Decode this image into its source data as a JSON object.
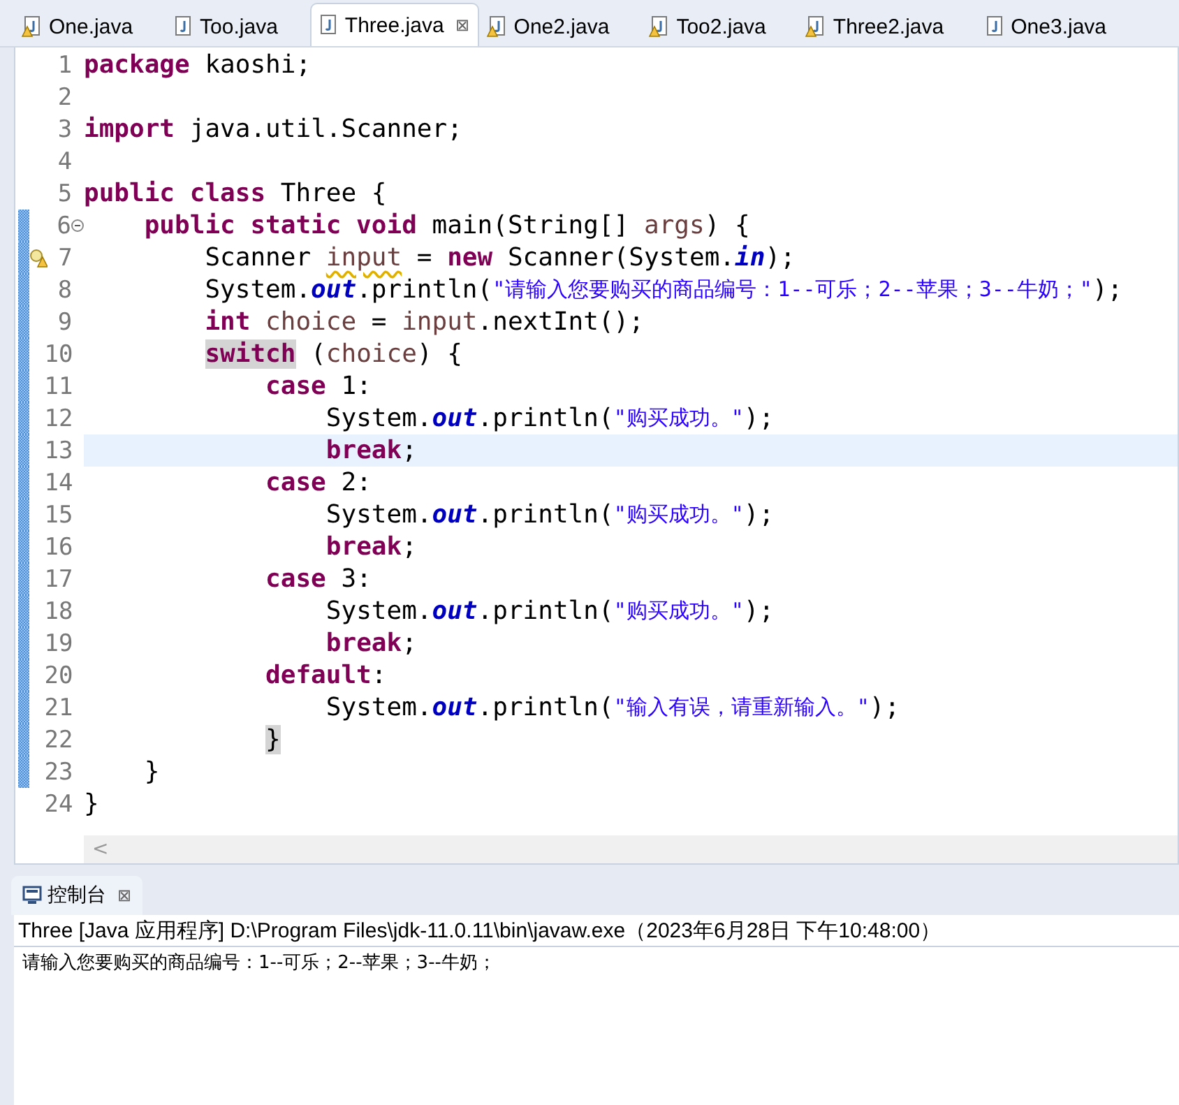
{
  "tabs": [
    {
      "label": "One.java",
      "warning": true,
      "selected": false
    },
    {
      "label": "Too.java",
      "warning": false,
      "selected": false
    },
    {
      "label": "Three.java",
      "warning": false,
      "selected": true,
      "close": "⊠"
    },
    {
      "label": "One2.java",
      "warning": true,
      "selected": false
    },
    {
      "label": "Too2.java",
      "warning": true,
      "selected": false
    },
    {
      "label": "Three2.java",
      "warning": true,
      "selected": false
    },
    {
      "label": "One3.java",
      "warning": false,
      "selected": false
    }
  ],
  "editor": {
    "lines": [
      {
        "number": "1",
        "changed": false,
        "tokens": [
          {
            "t": "package",
            "kind": "kw"
          },
          {
            "t": " kaoshi;",
            "kind": "plain"
          }
        ]
      },
      {
        "number": "2",
        "changed": false
      },
      {
        "number": "3",
        "changed": false,
        "tokens": [
          {
            "t": "import",
            "kind": "kw"
          },
          {
            "t": " java.util.Scanner;",
            "kind": "plain"
          }
        ]
      },
      {
        "number": "4",
        "changed": false
      },
      {
        "number": "5",
        "changed": false,
        "tokens": [
          {
            "t": "public class",
            "kind": "kw"
          },
          {
            "t": " Three {",
            "kind": "plain"
          }
        ],
        "children": [
          {
            "number": "6",
            "changed": true,
            "fold": true,
            "tokens": [
              {
                "t": "public static void",
                "kind": "kw"
              },
              {
                "t": " main(String[] ",
                "kind": "plain"
              },
              {
                "t": "args",
                "kind": "var"
              },
              {
                "t": ") {",
                "kind": "plain"
              }
            ],
            "children": [
              {
                "number": "7",
                "changed": true,
                "warning": true,
                "tokens": [
                  {
                    "t": "Scanner ",
                    "kind": "plain"
                  },
                  {
                    "t": "input",
                    "kind": "var",
                    "squiggle": true
                  },
                  {
                    "t": " = ",
                    "kind": "plain"
                  },
                  {
                    "t": "new",
                    "kind": "kw"
                  },
                  {
                    "t": " Scanner(System.",
                    "kind": "plain"
                  },
                  {
                    "t": "in",
                    "kind": "field"
                  },
                  {
                    "t": ");",
                    "kind": "plain"
                  }
                ]
              },
              {
                "number": "8",
                "changed": true,
                "tokens": [
                  {
                    "t": "System.",
                    "kind": "plain"
                  },
                  {
                    "t": "out",
                    "kind": "field"
                  },
                  {
                    "t": ".println(",
                    "kind": "plain"
                  },
                  {
                    "t": "\"请输入您要购买的商品编号：1--可乐；2--苹果；3--牛奶；\"",
                    "kind": "str"
                  },
                  {
                    "t": ");",
                    "kind": "plain"
                  }
                ]
              },
              {
                "number": "9",
                "changed": true,
                "tokens": [
                  {
                    "t": "int",
                    "kind": "kw"
                  },
                  {
                    "t": " choice",
                    "kind": "var"
                  },
                  {
                    "t": " = ",
                    "kind": "plain"
                  },
                  {
                    "t": "input",
                    "kind": "var"
                  },
                  {
                    "t": ".nextInt();",
                    "kind": "plain"
                  }
                ]
              },
              {
                "number": "10",
                "changed": true,
                "tokens": [
                  {
                    "t": "switch",
                    "kind": "kw",
                    "marked": true
                  },
                  {
                    "t": " (",
                    "kind": "plain"
                  },
                  {
                    "t": "choice",
                    "kind": "var"
                  },
                  {
                    "t": ") {",
                    "kind": "plain"
                  }
                ],
                "children": [
                  {
                    "number": "11",
                    "changed": true,
                    "tokens": [
                      {
                        "t": "case",
                        "kind": "kw"
                      },
                      {
                        "t": " 1:",
                        "kind": "plain"
                      }
                    ],
                    "children": [
                      {
                        "number": "12",
                        "changed": true,
                        "tokens": [
                          {
                            "t": "System.",
                            "kind": "plain"
                          },
                          {
                            "t": "out",
                            "kind": "field"
                          },
                          {
                            "t": ".println(",
                            "kind": "plain"
                          },
                          {
                            "t": "\"购买成功。\"",
                            "kind": "str"
                          },
                          {
                            "t": ");",
                            "kind": "plain"
                          }
                        ]
                      },
                      {
                        "number": "13",
                        "changed": true,
                        "current": true,
                        "tokens": [
                          {
                            "t": "break",
                            "kind": "kw"
                          },
                          {
                            "t": ";",
                            "kind": "plain"
                          }
                        ]
                      }
                    ]
                  },
                  {
                    "number": "14",
                    "changed": true,
                    "tokens": [
                      {
                        "t": "case",
                        "kind": "kw"
                      },
                      {
                        "t": " 2:",
                        "kind": "plain"
                      }
                    ],
                    "children": [
                      {
                        "number": "15",
                        "changed": true,
                        "tokens": [
                          {
                            "t": "System.",
                            "kind": "plain"
                          },
                          {
                            "t": "out",
                            "kind": "field"
                          },
                          {
                            "t": ".println(",
                            "kind": "plain"
                          },
                          {
                            "t": "\"购买成功。\"",
                            "kind": "str"
                          },
                          {
                            "t": ");",
                            "kind": "plain"
                          }
                        ]
                      },
                      {
                        "number": "16",
                        "changed": true,
                        "tokens": [
                          {
                            "t": "break",
                            "kind": "kw"
                          },
                          {
                            "t": ";",
                            "kind": "plain"
                          }
                        ]
                      }
                    ]
                  },
                  {
                    "number": "17",
                    "changed": true,
                    "tokens": [
                      {
                        "t": "case",
                        "kind": "kw"
                      },
                      {
                        "t": " 3:",
                        "kind": "plain"
                      }
                    ],
                    "children": [
                      {
                        "number": "18",
                        "changed": true,
                        "tokens": [
                          {
                            "t": "System.",
                            "kind": "plain"
                          },
                          {
                            "t": "out",
                            "kind": "field"
                          },
                          {
                            "t": ".println(",
                            "kind": "plain"
                          },
                          {
                            "t": "\"购买成功。\"",
                            "kind": "str"
                          },
                          {
                            "t": ");",
                            "kind": "plain"
                          }
                        ]
                      },
                      {
                        "number": "19",
                        "changed": true,
                        "tokens": [
                          {
                            "t": "break",
                            "kind": "kw"
                          },
                          {
                            "t": ";",
                            "kind": "plain"
                          }
                        ]
                      }
                    ]
                  },
                  {
                    "number": "20",
                    "changed": true,
                    "tokens": [
                      {
                        "t": "default",
                        "kind": "kw"
                      },
                      {
                        "t": ":",
                        "kind": "plain"
                      }
                    ],
                    "children": [
                      {
                        "number": "21",
                        "changed": true,
                        "tokens": [
                          {
                            "t": "System.",
                            "kind": "plain"
                          },
                          {
                            "t": "out",
                            "kind": "field"
                          },
                          {
                            "t": ".println(",
                            "kind": "plain"
                          },
                          {
                            "t": "\"输入有误，请重新输入。\"",
                            "kind": "str"
                          },
                          {
                            "t": ");",
                            "kind": "plain"
                          }
                        ]
                      }
                    ]
                  },
                  {
                    "number": "22",
                    "changed": true,
                    "tokens": [
                      {
                        "t": "}",
                        "kind": "plain",
                        "marked": true
                      }
                    ]
                  }
                ]
              }
            ]
          },
          {
            "number": "23",
            "changed": true,
            "tokens": [
              {
                "t": "}",
                "kind": "plain"
              }
            ]
          }
        ]
      },
      {
        "number": "24",
        "changed": false,
        "tokens": [
          {
            "t": "}",
            "kind": "plain"
          }
        ]
      }
    ],
    "scroll_left": "<"
  },
  "console": {
    "tab": {
      "label": "控制台",
      "close": "⊠"
    },
    "header": "Three [Java 应用程序] D:\\Program Files\\jdk-11.0.11\\bin\\javaw.exe（2023年6月28日 下午10:48:00）",
    "output": "请输入您要购买的商品编号：1--可乐；2--苹果；3--牛奶；"
  }
}
